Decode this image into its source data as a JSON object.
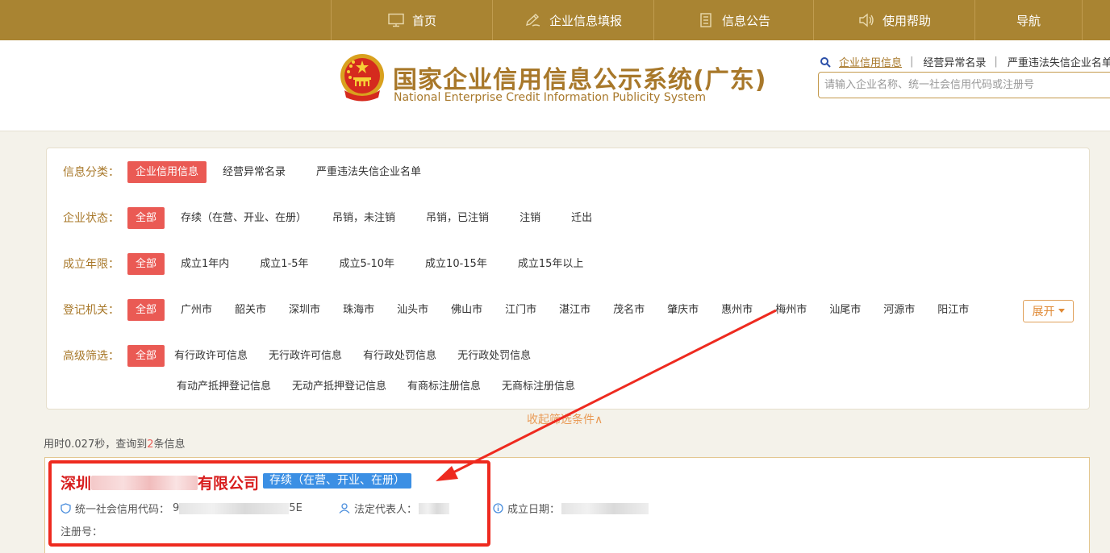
{
  "nav": {
    "items": [
      {
        "label": "首页",
        "icon": "monitor-icon"
      },
      {
        "label": "企业信息填报",
        "icon": "pen-icon"
      },
      {
        "label": "信息公告",
        "icon": "document-icon"
      },
      {
        "label": "使用帮助",
        "icon": "speaker-icon"
      },
      {
        "label": "导航",
        "icon": ""
      }
    ]
  },
  "header": {
    "title": "国家企业信用信息公示系统(广东)",
    "subtitle": "National Enterprise Credit Information Publicity System",
    "quick_links": [
      "企业信用信息",
      "经营异常名录",
      "严重违法失信企业名单"
    ],
    "search_placeholder": "请输入企业名称、统一社会信用代码或注册号"
  },
  "filters": {
    "category": {
      "label": "信息分类：",
      "options": [
        "企业信用信息",
        "经营异常名录",
        "严重违法失信企业名单"
      ]
    },
    "status": {
      "label": "企业状态：",
      "options": [
        "全部",
        "存续（在营、开业、在册）",
        "吊销，未注销",
        "吊销，已注销",
        "注销",
        "迁出"
      ]
    },
    "age": {
      "label": "成立年限：",
      "options": [
        "全部",
        "成立1年内",
        "成立1-5年",
        "成立5-10年",
        "成立10-15年",
        "成立15年以上"
      ]
    },
    "authority": {
      "label": "登记机关：",
      "options": [
        "全部",
        "广州市",
        "韶关市",
        "深圳市",
        "珠海市",
        "汕头市",
        "佛山市",
        "江门市",
        "湛江市",
        "茂名市",
        "肇庆市",
        "惠州市",
        "梅州市",
        "汕尾市",
        "河源市",
        "阳江市"
      ]
    },
    "advanced": {
      "label": "高级筛选：",
      "options_row1": [
        "全部",
        "有行政许可信息",
        "无行政许可信息",
        "有行政处罚信息",
        "无行政处罚信息"
      ],
      "options_row2": [
        "有动产抵押登记信息",
        "无动产抵押登记信息",
        "有商标注册信息",
        "无商标注册信息"
      ]
    },
    "expand_label": "展开",
    "collapse_label": "收起筛选条件∧"
  },
  "summary": {
    "prefix": "用时0.027秒，查询到",
    "count": "2",
    "suffix": "条信息"
  },
  "result": {
    "name_prefix": "深圳",
    "name_suffix": "有限公司",
    "status": "存续（在营、开业、在册）",
    "credit_code_label": "统一社会信用代码：",
    "credit_code_start": "9",
    "credit_code_end": "5E",
    "legal_rep_label": "法定代表人：",
    "founded_label": "成立日期：",
    "reg_no_label": "注册号："
  },
  "colors": {
    "nav_bg": "#a98432",
    "accent": "#a8782a",
    "selected_chip": "#ea5a54",
    "status_badge": "#3b8fe4",
    "annotation": "#ee2a1f"
  }
}
